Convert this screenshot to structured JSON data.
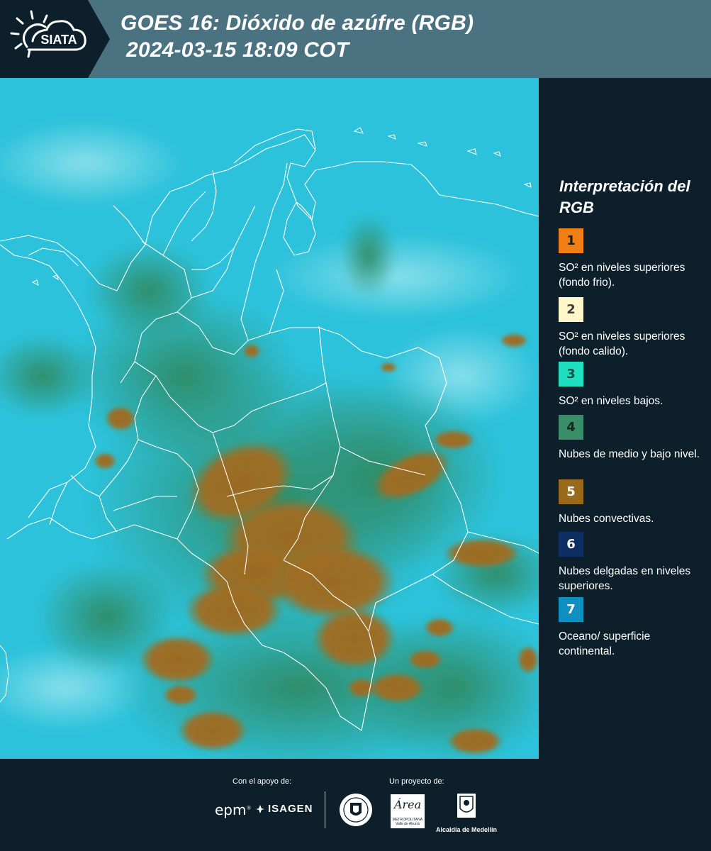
{
  "header": {
    "brand": "SIATA",
    "title_line1": "GOES 16: Dióxido de azúfre (RGB)",
    "title_line2": "2024-03-15 18:09 COT",
    "colors": {
      "bar": "#4a7280",
      "logo_bg": "#0c1f2b"
    }
  },
  "map": {
    "icon": "satellite-rgb-map",
    "colors": {
      "ocean_surface": "#2ec3dc",
      "low_mid_clouds": "#3e8f6a",
      "convective": "#9a6a24",
      "borders": "#ffffff"
    }
  },
  "legend": {
    "title": "Interpretación del RGB",
    "items": [
      {
        "number": "1",
        "label": "SO² en niveles superiores (fondo frio).",
        "color": "#f07f15",
        "text_color": "#1b1b1b"
      },
      {
        "number": "2",
        "label": "SO² en niveles superiores (fondo calido).",
        "color": "#fff6c9",
        "text_color": "#3c3c3c"
      },
      {
        "number": "3",
        "label": "SO² en niveles bajos.",
        "color": "#1ee0c0",
        "text_color": "#1c4d4a"
      },
      {
        "number": "4",
        "label": "Nubes de medio y bajo nivel.",
        "color": "#3a8e67",
        "text_color": "#0f2b1f"
      },
      {
        "number": "5",
        "label": "Nubes convectivas.",
        "color": "#9a6a1c",
        "text_color": "#ffffff"
      },
      {
        "number": "6",
        "label": "Nubes delgadas en niveles superiores.",
        "color": "#0d2f63",
        "text_color": "#ffffff"
      },
      {
        "number": "7",
        "label": "Oceano/ superficie continental.",
        "color": "#1090c0",
        "text_color": "#ffffff"
      }
    ]
  },
  "footer": {
    "support_label": "Con el apoyo de:",
    "project_label": "Un proyecto de:",
    "sponsors": [
      "epm",
      "ISAGEN"
    ],
    "partners": [
      "Área Metropolitana",
      "Alcaldía de Medellín"
    ],
    "area_text": "Área",
    "area_subtext": "METROPOLITANA Valle de Aburrá",
    "alcaldia_text": "Alcaldía de Medellín"
  }
}
